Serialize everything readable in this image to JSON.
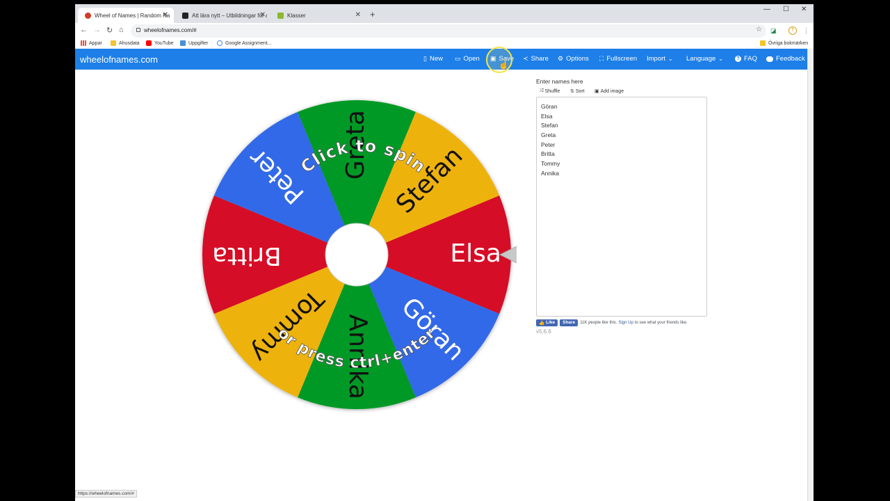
{
  "tabs": [
    {
      "title": "Wheel of Names | Random Name Picker",
      "favicon_color": "#d23b2a",
      "active": true
    },
    {
      "title": "Att lära nytt – Utbildningar för alla",
      "favicon_color": "#222222",
      "active": false
    },
    {
      "title": "Klasser",
      "favicon_color": "#8bb82e",
      "active": false
    }
  ],
  "new_tab_glyph": "+",
  "window_controls": {
    "minimize": "—",
    "maximize": "☐",
    "close": "✕"
  },
  "address_bar": {
    "url": "wheelofnames.com/#"
  },
  "bookmarks": [
    {
      "label": "Appar",
      "color": "#e74c3c"
    },
    {
      "label": "Ahusdata",
      "color": "#f4c430"
    },
    {
      "label": "YouTube",
      "color": "#ff0000"
    },
    {
      "label": "Uppgifter",
      "color": "#4a90d9"
    },
    {
      "label": "Google Assignment...",
      "color": "#34a853"
    }
  ],
  "other_bookmarks": "Övriga bokmärken",
  "app": {
    "brand": "wheelofnames.com",
    "nav": [
      {
        "label": "New",
        "icon": "file-icon",
        "glyph": "🗋"
      },
      {
        "label": "Open",
        "icon": "folder-open-icon",
        "glyph": "📂"
      },
      {
        "label": "Save",
        "icon": "floppy-disk-icon",
        "glyph": "💾"
      },
      {
        "label": "Share",
        "icon": "share-icon",
        "glyph": "⤴"
      },
      {
        "label": "Options",
        "icon": "gear-icon",
        "glyph": "⚙"
      },
      {
        "label": "Fullscreen",
        "icon": "expand-icon",
        "glyph": "⛶"
      },
      {
        "label": "Import",
        "icon": "",
        "glyph": ""
      },
      {
        "label": "Language",
        "icon": "",
        "glyph": ""
      },
      {
        "label": "FAQ",
        "icon": "question-circle-icon",
        "glyph": "?"
      },
      {
        "label": "Feedback",
        "icon": "comment-icon",
        "glyph": "💬"
      }
    ]
  },
  "wheel": {
    "segments": [
      {
        "name": "Elsa",
        "color": "#d61126"
      },
      {
        "name": "Göran",
        "color": "#3369e8"
      },
      {
        "name": "Annika",
        "color": "#009925"
      },
      {
        "name": "Tommy",
        "color": "#eeb211"
      },
      {
        "name": "Britta",
        "color": "#d61126"
      },
      {
        "name": "Peter",
        "color": "#3369e8"
      },
      {
        "name": "Greta",
        "color": "#009925"
      },
      {
        "name": "Stefan",
        "color": "#eeb211"
      }
    ],
    "instruction_top": "Click to spin",
    "instruction_bottom": "or press ctrl+enter"
  },
  "names_panel": {
    "heading": "Enter names here",
    "tools": [
      {
        "label": "Shuffle",
        "icon": "shuffle-icon",
        "glyph": "⤮"
      },
      {
        "label": "Sort",
        "icon": "sort-icon",
        "glyph": "⇅"
      },
      {
        "label": "Add image",
        "icon": "image-icon",
        "glyph": "▣"
      }
    ],
    "names": [
      "Göran",
      "Elsa",
      "Stefan",
      "Greta",
      "Peter",
      "Britta",
      "Tommy",
      "Annika"
    ]
  },
  "facebook": {
    "like": "Like",
    "share": "Share",
    "text_before": "11K people like this.",
    "signup": "Sign Up",
    "text_after": "to see what your friends like."
  },
  "version": "v5.6.6",
  "status_url": "https://wheelofnames.com/#"
}
